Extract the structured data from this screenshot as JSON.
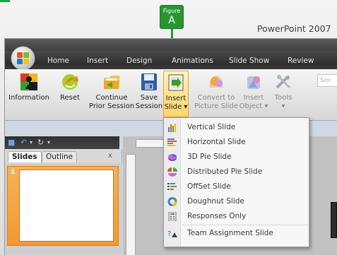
{
  "figure": {
    "small": "Figure",
    "big": "A"
  },
  "caption": "PowerPoint 2007",
  "tabs": [
    "Home",
    "Insert",
    "Design",
    "Animations",
    "Slide Show",
    "Review"
  ],
  "ribbon": [
    {
      "line1": "Information",
      "line2": "",
      "icon": "information-icon"
    },
    {
      "line1": "Reset",
      "line2": "",
      "icon": "reset-icon",
      "dropdown": true
    },
    {
      "line1": "Continue",
      "line2": "Prior Session",
      "icon": "continue-session-icon"
    },
    {
      "line1": "Save",
      "line2": "Session",
      "icon": "save-session-icon"
    },
    {
      "line1": "Insert",
      "line2": "Slide",
      "icon": "insert-slide-icon",
      "dropdown": true
    },
    {
      "line1": "Convert to",
      "line2": "Picture Slide",
      "icon": "convert-picture-icon"
    },
    {
      "line1": "Insert",
      "line2": "Object",
      "icon": "insert-object-icon",
      "dropdown": true
    },
    {
      "line1": "Tools",
      "line2": "",
      "icon": "tools-icon",
      "dropdown": true
    }
  ],
  "search_stub": "Sim",
  "panel": {
    "tab_slides": "Slides",
    "tab_outline": "Outline",
    "close": "x",
    "slide_number": "1"
  },
  "menu": [
    {
      "label": "Vertical Slide",
      "icon": "vertical-bars-icon"
    },
    {
      "label": "Horizontal Slide",
      "icon": "horizontal-bars-icon"
    },
    {
      "label": "3D Pie Slide",
      "icon": "3d-pie-icon"
    },
    {
      "label": "Distributed Pie Slide",
      "icon": "distributed-pie-icon"
    },
    {
      "label": "OffSet Slide",
      "icon": "offset-icon"
    },
    {
      "label": "Doughnut Slide",
      "icon": "doughnut-icon"
    },
    {
      "label": "Responses Only",
      "icon": "responses-icon"
    },
    {
      "label": "Team Assignment Slide",
      "icon": "team-assignment-icon"
    }
  ],
  "colors": {
    "accent_green": "#26972f",
    "menu_bg": "#f7f7f7",
    "ribbon_dark": "#3a3a3a"
  }
}
